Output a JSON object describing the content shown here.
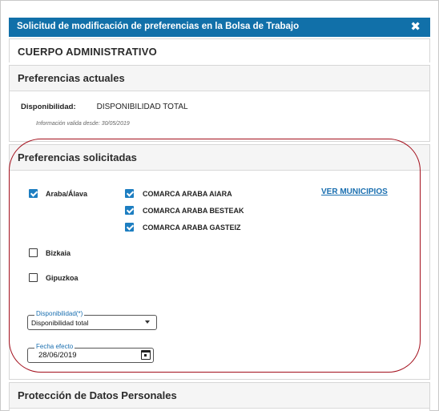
{
  "dialog": {
    "title": "Solicitud de modificación de preferencias en la Bolsa de Trabajo",
    "close_glyph": "✖",
    "cuerpo": "CUERPO ADMINISTRATIVO"
  },
  "actuales": {
    "header": "Preferencias actuales",
    "disponibilidad_label": "Disponibilidad:",
    "disponibilidad_value": "DISPONIBILIDAD TOTAL",
    "valida_desde": "Información valida desde: 30/05/2019"
  },
  "solicitadas": {
    "header": "Preferencias solicitadas",
    "provinces": [
      {
        "label": "Araba/Álava",
        "checked": true
      },
      {
        "label": "Bizkaia",
        "checked": false
      },
      {
        "label": "Gipuzkoa",
        "checked": false
      }
    ],
    "comarcas": [
      {
        "label": "COMARCA ARABA AIARA",
        "checked": true
      },
      {
        "label": "COMARCA ARABA BESTEAK",
        "checked": true
      },
      {
        "label": "COMARCA ARABA GASTEIZ",
        "checked": true
      }
    ],
    "ver_municipios": "VER MUNICIPIOS",
    "disponibilidad_field": {
      "legend": "Disponibilidad(*)",
      "value": "Disponibilidad total"
    },
    "fecha_field": {
      "legend": "Fecha efecto",
      "value": "28/06/2019"
    }
  },
  "proteccion": {
    "header": "Protección de Datos Personales"
  },
  "colors": {
    "titlebar": "#1170a9",
    "checkbox_checked": "#1d7ec1",
    "link": "#1a6fb0",
    "highlight_outline": "#a30f1c"
  }
}
